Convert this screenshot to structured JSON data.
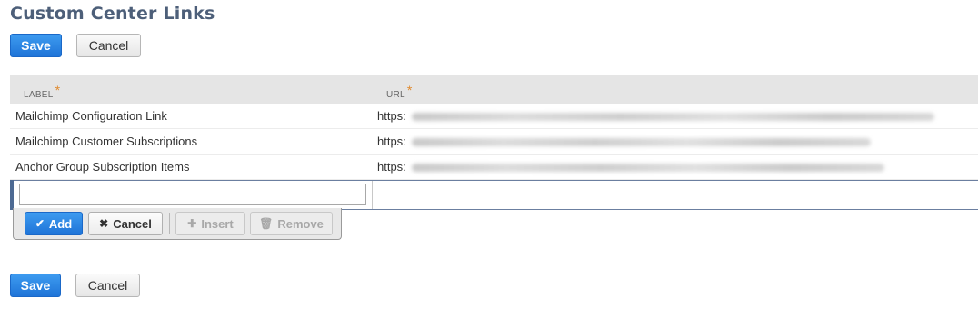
{
  "page": {
    "title": "Custom Center Links"
  },
  "top_actions": {
    "save_label": "Save",
    "cancel_label": "Cancel"
  },
  "bottom_actions": {
    "save_label": "Save",
    "cancel_label": "Cancel"
  },
  "grid": {
    "columns": [
      {
        "label": "LABEL",
        "required_mark": "*"
      },
      {
        "label": "URL",
        "required_mark": "*"
      }
    ],
    "rows": [
      {
        "label": "Mailchimp Configuration Link",
        "url_prefix": "https:"
      },
      {
        "label": "Mailchimp Customer Subscriptions",
        "url_prefix": "https:"
      },
      {
        "label": "Anchor Group Subscription Items",
        "url_prefix": "https:"
      }
    ],
    "new_row": {
      "label_value": "",
      "url_value": ""
    }
  },
  "row_toolbar": {
    "add_label": "Add",
    "cancel_label": "Cancel",
    "insert_label": "Insert",
    "remove_label": "Remove",
    "add_icon": "check-icon",
    "cancel_icon": "x-icon",
    "insert_icon": "plus-icon",
    "remove_icon": "trash-icon"
  },
  "colors": {
    "title": "#4d5f79",
    "primary_button": "#1f74d8",
    "required_asterisk": "#e08a2e",
    "header_bg": "#e5e5e5"
  }
}
